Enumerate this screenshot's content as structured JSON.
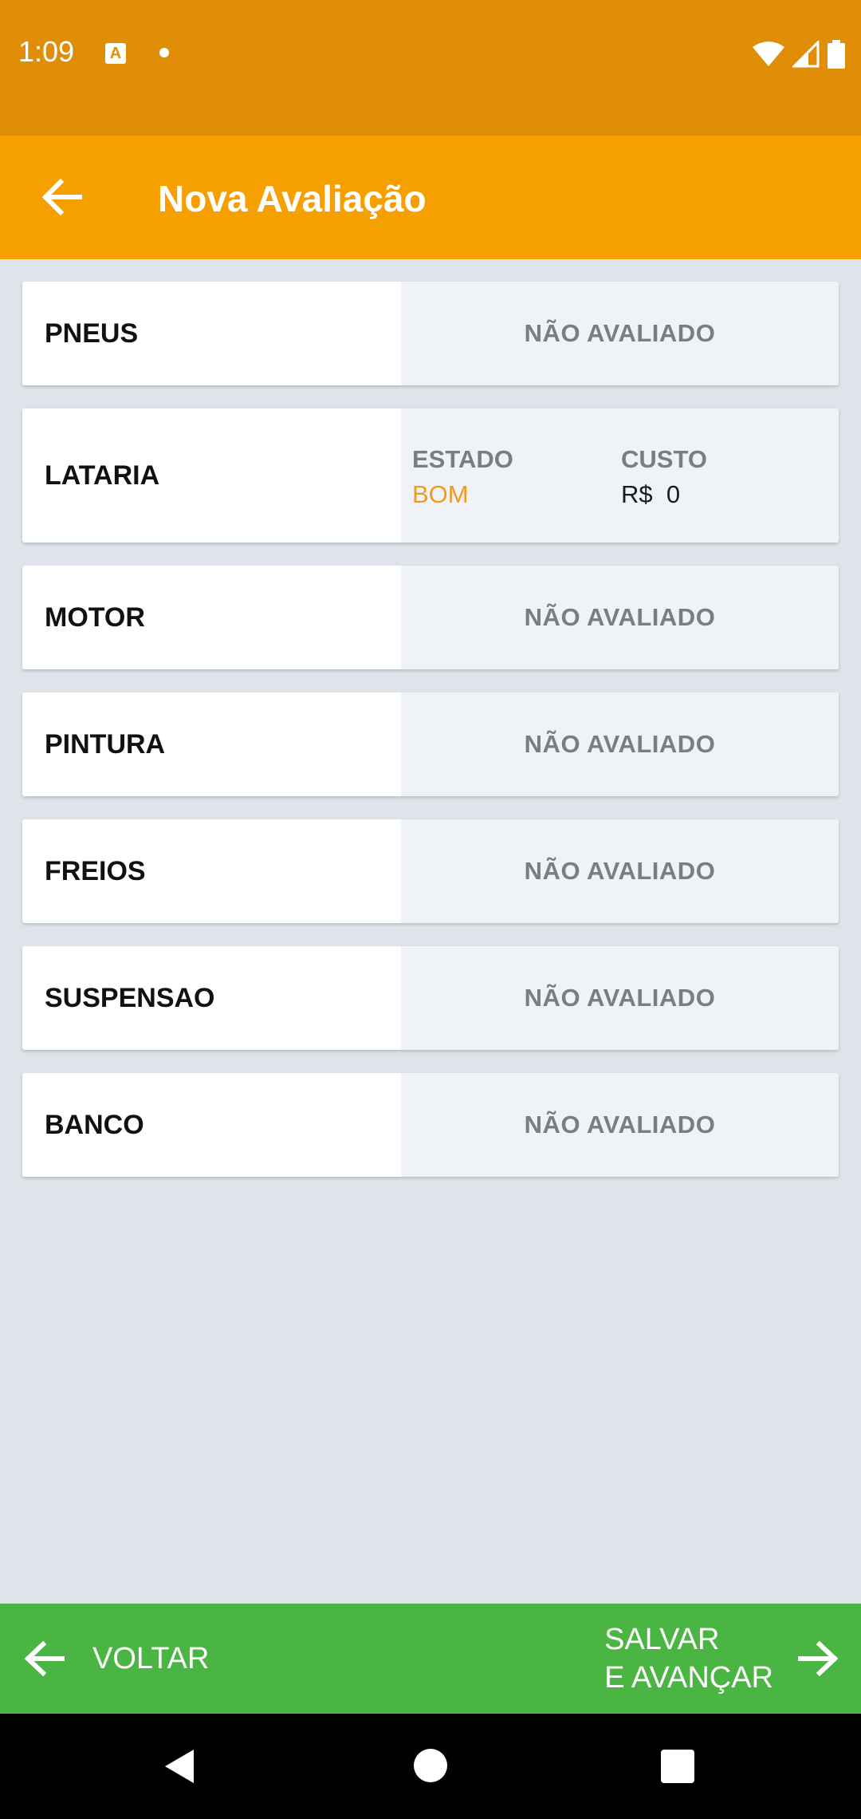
{
  "status_bar": {
    "time": "1:09",
    "notification_letter": "A",
    "icons": [
      "wifi-icon",
      "cell-signal-icon",
      "battery-icon"
    ]
  },
  "app_bar": {
    "title": "Nova Avaliação"
  },
  "items": [
    {
      "name": "PNEUS",
      "status": "NÃO AVALIADO"
    },
    {
      "name": "LATARIA",
      "estado_label": "ESTADO",
      "estado_value": "BOM",
      "custo_label": "CUSTO",
      "custo_value": "R$  0"
    },
    {
      "name": "MOTOR",
      "status": "NÃO AVALIADO"
    },
    {
      "name": "PINTURA",
      "status": "NÃO AVALIADO"
    },
    {
      "name": "FREIOS",
      "status": "NÃO AVALIADO"
    },
    {
      "name": "SUSPENSAO",
      "status": "NÃO AVALIADO"
    },
    {
      "name": "BANCO",
      "status": "NÃO AVALIADO"
    }
  ],
  "bottom_bar": {
    "back_label": "VOLTAR",
    "next_label_line1": "SALVAR",
    "next_label_line2": "E AVANÇAR"
  },
  "colors": {
    "status_bar": "#e08e08",
    "app_bar": "#f5a000",
    "bottom_bar": "#4bb543",
    "estado_good": "#f39a1e"
  }
}
